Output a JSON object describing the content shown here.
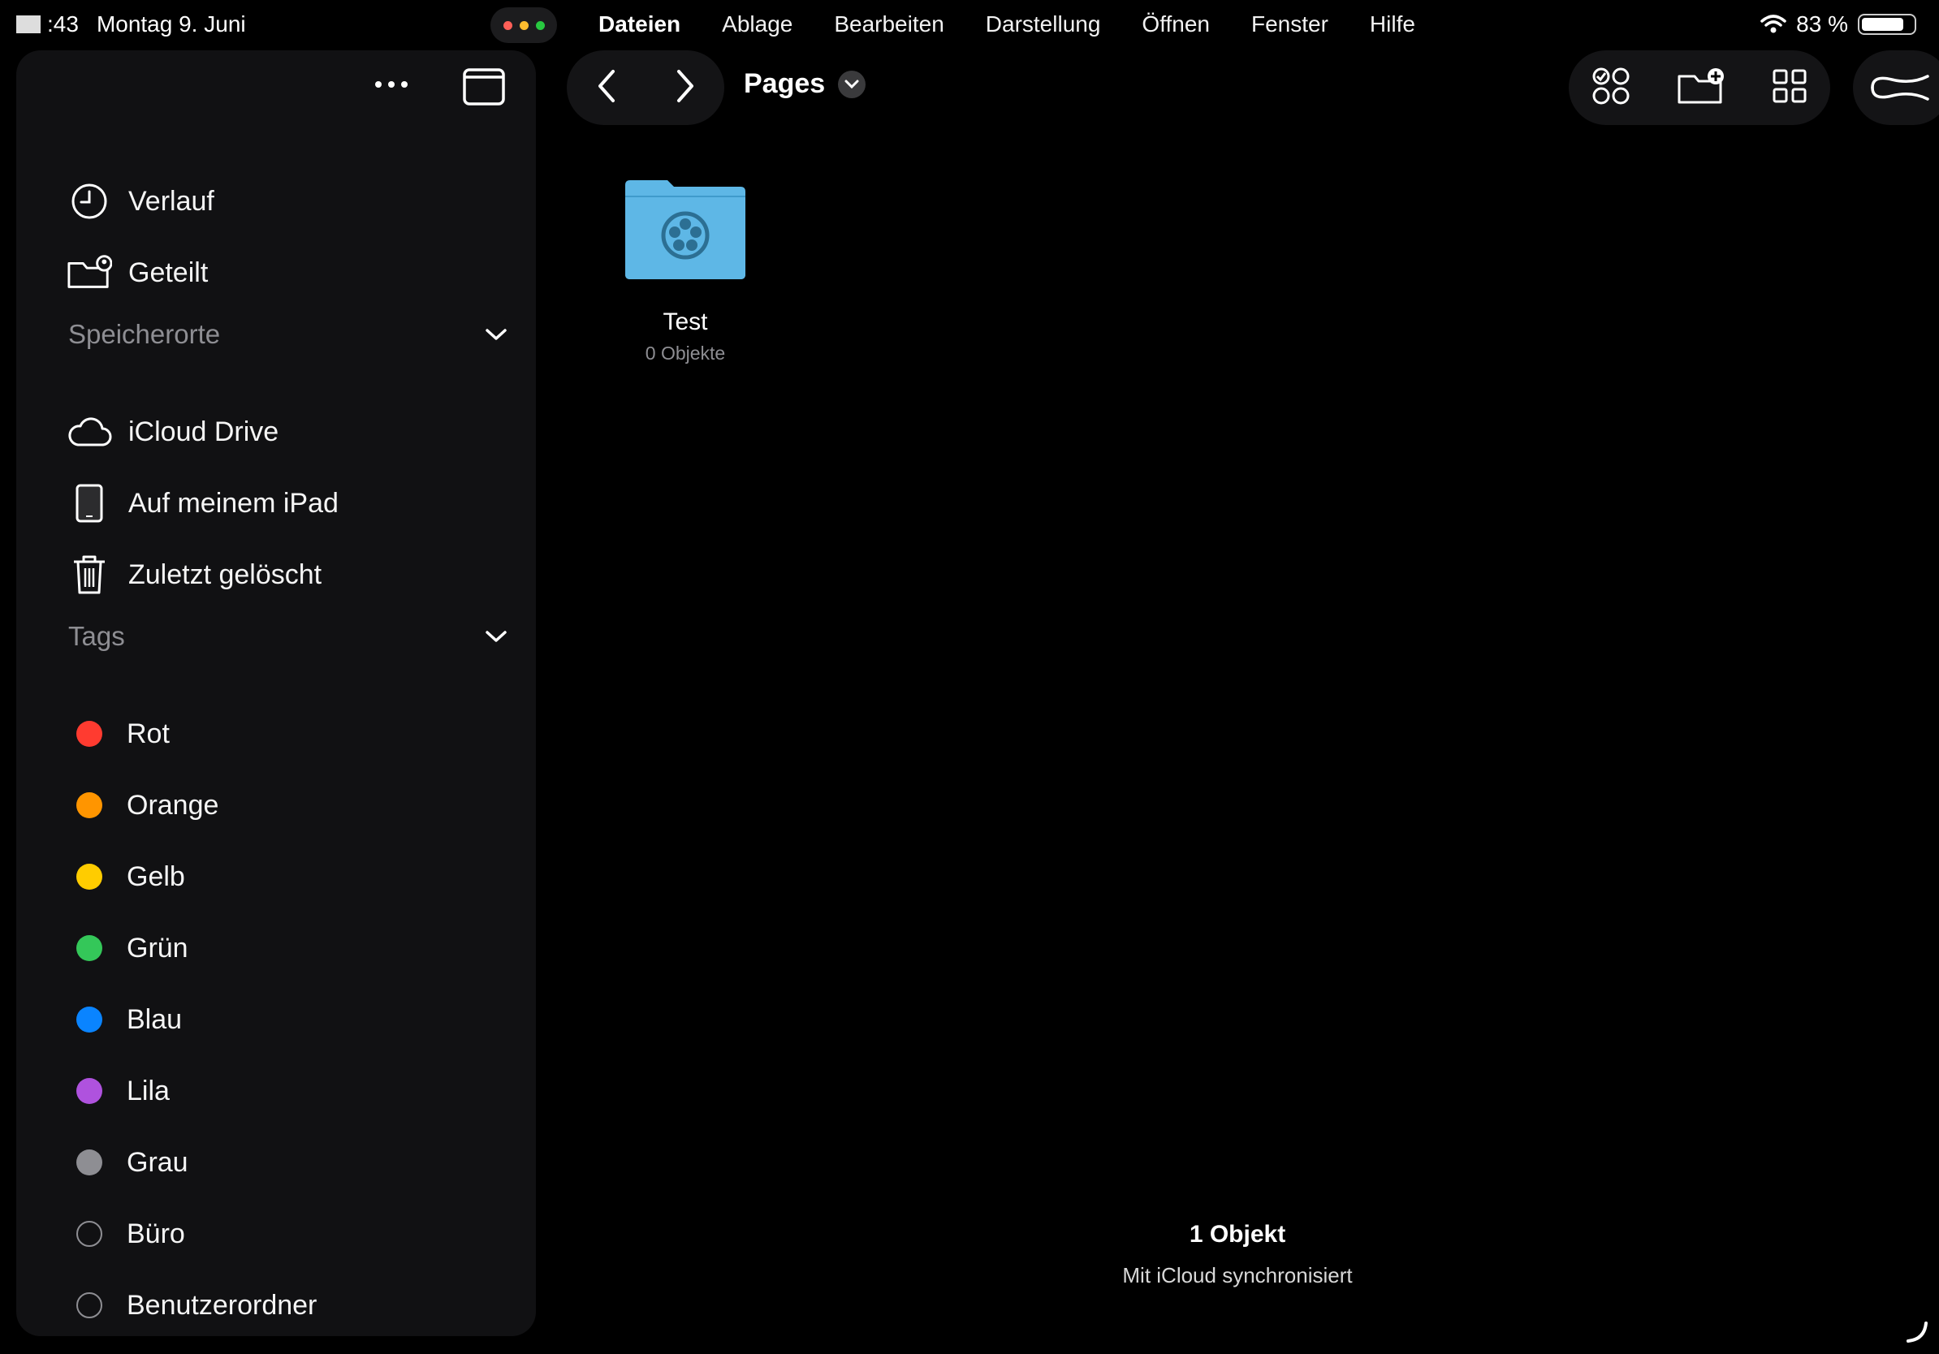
{
  "status": {
    "time": ":43",
    "date": "Montag 9. Juni",
    "battery_percent": "83 %",
    "battery_level": 0.83
  },
  "menu": [
    "Dateien",
    "Ablage",
    "Bearbeiten",
    "Darstellung",
    "Öffnen",
    "Fenster",
    "Hilfe"
  ],
  "window_controls": {
    "colors": [
      "#ff5f57",
      "#febc2e",
      "#28c840"
    ]
  },
  "sidebar": {
    "top_items": [
      {
        "label": "Verlauf",
        "icon": "clock-icon"
      },
      {
        "label": "Geteilt",
        "icon": "shared-folder-icon"
      }
    ],
    "locations": {
      "header": "Speicherorte",
      "items": [
        {
          "label": "iCloud Drive",
          "icon": "cloud-icon"
        },
        {
          "label": "Auf meinem iPad",
          "icon": "ipad-icon"
        },
        {
          "label": "Zuletzt gelöscht",
          "icon": "trash-icon"
        }
      ]
    },
    "tags": {
      "header": "Tags",
      "items": [
        {
          "label": "Rot",
          "color": "#ff3b30"
        },
        {
          "label": "Orange",
          "color": "#ff9500"
        },
        {
          "label": "Gelb",
          "color": "#ffcc00"
        },
        {
          "label": "Grün",
          "color": "#34c759"
        },
        {
          "label": "Blau",
          "color": "#0a84ff"
        },
        {
          "label": "Lila",
          "color": "#af52de"
        },
        {
          "label": "Grau",
          "color": "#8e8e93"
        },
        {
          "label": "Büro",
          "color": ""
        },
        {
          "label": "Benutzerordner",
          "color": ""
        }
      ]
    }
  },
  "toolbar": {
    "location": "Pages"
  },
  "content": {
    "folder": {
      "name": "Test",
      "count": "0 Objekte",
      "color": "#5eb7e6"
    },
    "footer": {
      "count": "1 Objekt",
      "sync": "Mit iCloud synchronisiert"
    }
  }
}
